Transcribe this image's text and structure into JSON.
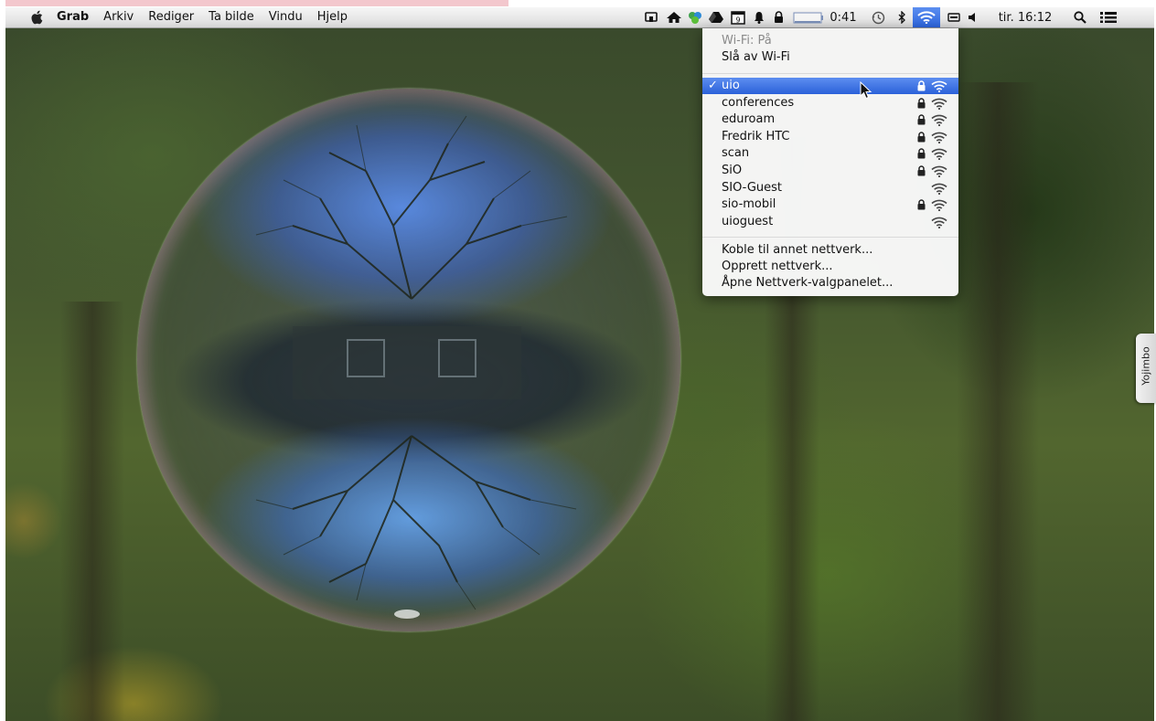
{
  "menubar": {
    "app_name": "Grab",
    "menus": [
      "Arkiv",
      "Rediger",
      "Ta bilde",
      "Vindu",
      "Hjelp"
    ],
    "status": {
      "battery_time": "0:41",
      "clock": "tir. 16:12",
      "icons": [
        "cast-icon",
        "home-icon",
        "recycle-icon",
        "drive-icon",
        "calendar-icon",
        "bell-icon",
        "lock-icon",
        "battery-icon",
        "time-machine-icon",
        "bluetooth-icon",
        "wifi-icon",
        "keyboard-icon",
        "volume-icon",
        "spotlight-icon",
        "notification-center-icon"
      ],
      "calendar_day": "9"
    }
  },
  "wifi_menu": {
    "status": "Wi-Fi: På",
    "toggle": "Slå av Wi-Fi",
    "networks": [
      {
        "name": "uio",
        "selected": true,
        "secured": true
      },
      {
        "name": "conferences",
        "selected": false,
        "secured": true
      },
      {
        "name": "eduroam",
        "selected": false,
        "secured": true
      },
      {
        "name": "Fredrik HTC",
        "selected": false,
        "secured": true
      },
      {
        "name": "scan",
        "selected": false,
        "secured": true
      },
      {
        "name": "SiO",
        "selected": false,
        "secured": true
      },
      {
        "name": "SIO-Guest",
        "selected": false,
        "secured": false
      },
      {
        "name": "sio-mobil",
        "selected": false,
        "secured": true
      },
      {
        "name": "uioguest",
        "selected": false,
        "secured": false
      }
    ],
    "checkmark": "✓",
    "actions": [
      "Koble til annet nettverk...",
      "Opprett nettverk...",
      "Åpne Nettverk-valgpanelet..."
    ]
  },
  "yojimbo": {
    "label": "Yojimbo"
  },
  "colors": {
    "selection": "#2b61d9",
    "menubar": "#e6e6e6",
    "bubble_pink": "#ff6ee0"
  }
}
